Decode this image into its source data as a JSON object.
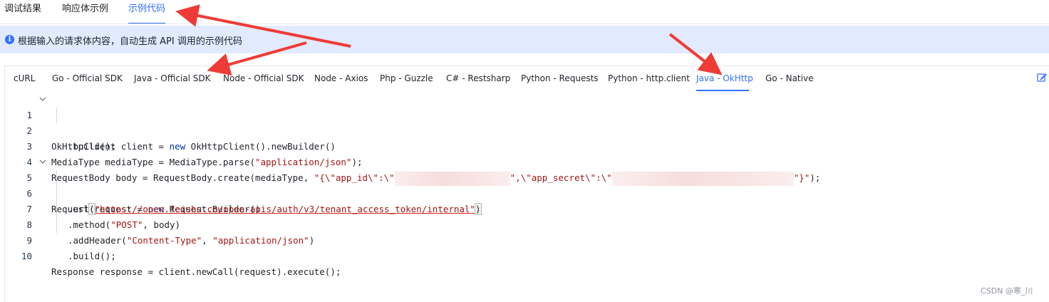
{
  "top_tabs": [
    "调试结果",
    "响应体示例",
    "示例代码"
  ],
  "top_tab_active": "示例代码",
  "banner": {
    "icon": "info-icon",
    "text": "根据输入的请求体内容，自动生成 API 调用的示例代码"
  },
  "lang_tabs": [
    "cURL",
    "Go - Official SDK",
    "Java - Official SDK",
    "Node - Official SDK",
    "Node - Axios",
    "Php - Guzzle",
    "C# - Restsharp",
    "Python - Requests",
    "Python - http.client",
    "Java - OkHttp",
    "Go - Native"
  ],
  "lang_tab_active": "Java - OkHttp",
  "edit_icon": "edit-icon",
  "code": {
    "language": "java",
    "line_numbers": [
      "1",
      "2",
      "3",
      "4",
      "5",
      "6",
      "7",
      "8",
      "9",
      "10"
    ],
    "lines": {
      "l1a": "OkHttpClient client = ",
      "l1kw": "new",
      "l1b": " OkHttpClient().newBuilder()",
      "l2": ".build();",
      "l3a": "MediaType mediaType = MediaType.parse(",
      "l3s": "\"application/json\"",
      "l3b": ");",
      "l4a": "RequestBody body = RequestBody.create(mediaType, ",
      "l4s1": "\"{\\\"app_id\\\":\\\"",
      "l4s2": "\",\\\"app_secret\\\":\\\"",
      "l4s3": "\"}\"",
      "l4b": ");",
      "l5a": "Request request = ",
      "l5kw": "new",
      "l5b": " Request.Builder()",
      "l6a": ".url",
      "l6p1": "(",
      "l6s": "\"https://open.feishu.cn/open-apis/auth/v3/tenant_access_token/internal\"",
      "l6p2": ")",
      "l7a": ".method(",
      "l7s": "\"POST\"",
      "l7b": ", body)",
      "l8a": ".addHeader(",
      "l8s1": "\"Content-Type\"",
      "l8m": ", ",
      "l8s2": "\"application/json\"",
      "l8b": ")",
      "l9": ".build();",
      "l10": "Response response = client.newCall(request).execute();"
    }
  },
  "watermark": "CSDN @寒_川",
  "colors": {
    "accent": "#3370ff",
    "banner_bg": "#e1eaff",
    "keyword": "#0033b3",
    "string": "#a31515",
    "annotation_arrow": "#ef3b36"
  }
}
